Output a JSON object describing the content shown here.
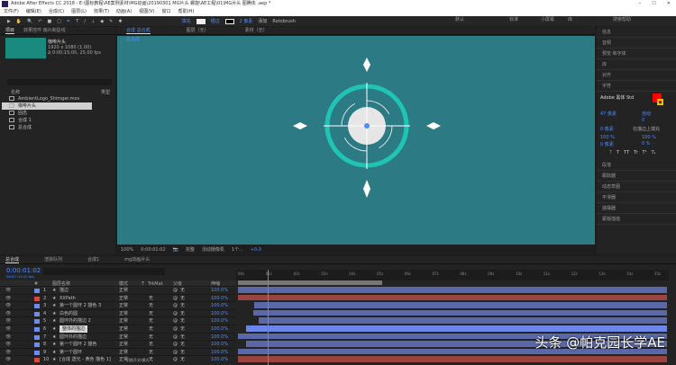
{
  "title": "Adobe After Effects CC 2018 - E:\\图标教程\\AE案例素材\\MG动画\\20190301 MG片头 螺旋\\AE工程\\01\\MG片头 图腾体 .aep *",
  "window_controls": [
    "–",
    "☐",
    "✕"
  ],
  "menu": [
    "文件(F)",
    "编辑(E)",
    "合成(C)",
    "图层(L)",
    "效果(T)",
    "动画(A)",
    "视图(V)",
    "窗口",
    "帮助(H)"
  ],
  "toolbar": {
    "fill": "填充",
    "stroke": "描边",
    "stroke_px": "2 像素",
    "add": "添加",
    "rotobrush": "Rotobrush"
  },
  "workspaces": [
    "默认",
    "标准",
    "小屏幕",
    "库"
  ],
  "search_help": "搜索帮助",
  "project": {
    "tabs": [
      "项目",
      "效果控件 扇片和星线"
    ],
    "comp_name": "咖啡片头",
    "comp_res": "1920 x 1080 (1.00)",
    "comp_dur": "Δ 0:00:15:00, 25.00 fps",
    "col_name": "名称",
    "col_type": "类型",
    "items": [
      "AmbientLogo_Shimger.mov",
      "咖啡片头",
      "固态",
      "合成 1",
      "总合成"
    ]
  },
  "viewer": {
    "tabs": [
      "合成 总合成",
      "图层（无）",
      "素材（无）"
    ],
    "subtab": "总合成",
    "zoom": "100%",
    "timecode": "0:00:01:02",
    "quality": "完整",
    "camera": "活动摄像机",
    "views": "1个...",
    "offset": "+0.0"
  },
  "right": {
    "panels_top": [
      "信息",
      "音频",
      "预览 和字体",
      "库",
      "对齐"
    ],
    "char_title": "字符",
    "font": "Adobe 黑体 Std",
    "size": "47 像素",
    "leading": "自动",
    "tracking": "0",
    "stroke_w": "0 像素",
    "stroke_type": "在描边上填充",
    "vscale": "100 %",
    "hscale": "100 %",
    "baseline": "0 像素",
    "tsume": "0 %",
    "styles": [
      "T",
      "T",
      "TT",
      "Tr",
      "T¹",
      "T₁"
    ],
    "panels_bottom": [
      "段落",
      "跟踪器",
      "动态草图",
      "平滑器",
      "摇摆器",
      "蒙版插值"
    ]
  },
  "timeline": {
    "tabs": [
      "总合成",
      "渲染队列",
      "合成1",
      "mg动画片头"
    ],
    "timecode": "0:00:01:02",
    "timecode_sub": "00027 (25.00 fps)",
    "headers": {
      "num": "#",
      "name": "图层名称",
      "mode": "模式",
      "t": "T",
      "trkmat": "TrkMat",
      "parent": "父级",
      "stretch": "伸缩"
    },
    "ruler": [
      "00s",
      "01s",
      "02s",
      "03s",
      "04s",
      "05s",
      "06s",
      "07s",
      "08s",
      "09s",
      "10s",
      "11s",
      "12s",
      "13s",
      "14s",
      "15s"
    ],
    "layers": [
      {
        "num": "1",
        "name": "描边",
        "color": "#6f8bf0",
        "mode": "正常",
        "trk": "",
        "parent": "无",
        "stretch": "100.0%",
        "bar": "#5a68a8",
        "start": 0
      },
      {
        "num": "2",
        "name": "XXPath",
        "color": "#d9463e",
        "mode": "正常",
        "trk": "无",
        "parent": "无",
        "stretch": "100.0%",
        "bar": "#9a4440",
        "start": 0
      },
      {
        "num": "3",
        "name": "第一个圆环 2 描色 3",
        "color": "#6f8bf0",
        "mode": "正常",
        "trk": "无",
        "parent": "无",
        "stretch": "100.0%",
        "bar": "#5a68a8",
        "start": 0.6
      },
      {
        "num": "4",
        "name": "白色的圆",
        "color": "#6f8bf0",
        "mode": "正常",
        "trk": "无",
        "parent": "无",
        "stretch": "100.0%",
        "bar": "#5a68a8",
        "start": 0.55
      },
      {
        "num": "5",
        "name": "圆环外的描边 2",
        "color": "#6f8bf0",
        "mode": "正常",
        "trk": "无",
        "parent": "无",
        "stretch": "100.0%",
        "bar": "#5a68a8",
        "start": 0.75
      },
      {
        "num": "6",
        "name": "整体的描边",
        "color": "#6f8bf0",
        "mode": "正常",
        "trk": "无",
        "parent": "无",
        "stretch": "100.0%",
        "bar": "#6a86e8",
        "start": 0.3,
        "selected": true
      },
      {
        "num": "7",
        "name": "圆环外的描边",
        "color": "#6f8bf0",
        "mode": "正常",
        "trk": "无",
        "parent": "无",
        "stretch": "100.0%",
        "bar": "#5a68a8",
        "start": 0
      },
      {
        "num": "8",
        "name": "第一个圆环 2 描色",
        "color": "#6f8bf0",
        "mode": "正常",
        "trk": "无",
        "parent": "无",
        "stretch": "100.0%",
        "bar": "#5a68a8",
        "start": 0.3
      },
      {
        "num": "9",
        "name": "第一个圆环",
        "color": "#6f8bf0",
        "mode": "正常",
        "trk": "无",
        "parent": "无",
        "stretch": "100.0%",
        "bar": "#5a68a8",
        "start": 0
      },
      {
        "num": "10",
        "name": "[合成 透光 - 黄色 描色 1]",
        "color": "#d9463e",
        "mode": "正常",
        "trk": "无",
        "parent": "无",
        "stretch": "100.0%",
        "bar": "#9a4440",
        "start": 0
      }
    ],
    "footer": "切换开关/模式"
  },
  "watermark": "头条 @帕克园长学AE",
  "colors": {
    "canvas": "#2c7b84",
    "ring": "#1fc4b4",
    "accent": "#4a8dff"
  }
}
